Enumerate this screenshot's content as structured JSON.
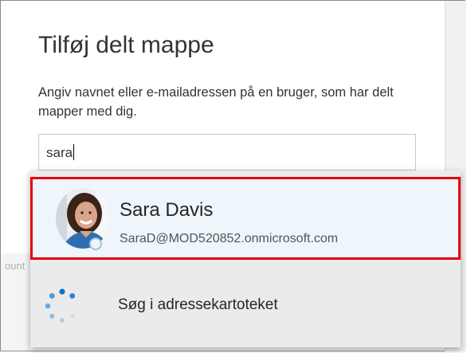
{
  "dialog": {
    "title": "Tilføj delt mappe",
    "description": "Angiv navnet eller e-mailadressen på en bruger, som har delt mapper med dig.",
    "search": {
      "value": "sara",
      "placeholder": ""
    },
    "behind_text": "ount"
  },
  "suggestions": [
    {
      "name": "Sara Davis",
      "email": "SaraD@MOD520852.onmicrosoft.com",
      "presence_icon": "presence-status-icon"
    }
  ],
  "directory_search": {
    "label": "Søg i adressekartoteket",
    "icon": "loading-spinner-icon"
  },
  "colors": {
    "highlight": "#e3000f",
    "accent": "#0078d4",
    "selected_row": "#eef5fb"
  }
}
